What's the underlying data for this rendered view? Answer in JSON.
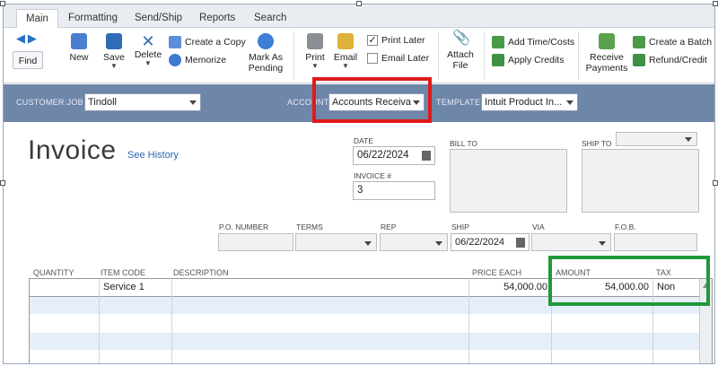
{
  "tabs": [
    "Main",
    "Formatting",
    "Send/Ship",
    "Reports",
    "Search"
  ],
  "toolbar": {
    "find": "Find",
    "new": "New",
    "save": "Save",
    "delete": "Delete",
    "create_copy": "Create a Copy",
    "memorize": "Memorize",
    "mark_as_pending_1": "Mark As",
    "mark_as_pending_2": "Pending",
    "print": "Print",
    "email": "Email",
    "print_later": "Print Later",
    "email_later": "Email Later",
    "attach_file_1": "Attach",
    "attach_file_2": "File",
    "add_time_costs": "Add Time/Costs",
    "apply_credits": "Apply Credits",
    "receive_payments_1": "Receive",
    "receive_payments_2": "Payments",
    "create_batch": "Create a Batch",
    "refund_credit": "Refund/Credit"
  },
  "header": {
    "customer_job_label": "CUSTOMER:JOB",
    "customer_job_value": "Tindoll",
    "account_label": "ACCOUNT",
    "account_value": "Accounts Receiva",
    "template_label": "TEMPLATE",
    "template_value": "Intuit Product In..."
  },
  "form": {
    "title": "Invoice",
    "see_history": "See History",
    "date_label": "DATE",
    "date_value": "06/22/2024",
    "invoice_no_label": "INVOICE #",
    "invoice_no_value": "3",
    "bill_to_label": "BILL TO",
    "ship_to_label": "SHIP TO",
    "po_number_label": "P.O. NUMBER",
    "terms_label": "TERMS",
    "rep_label": "REP",
    "ship_label": "SHIP",
    "ship_value": "06/22/2024",
    "via_label": "VIA",
    "fob_label": "F.O.B."
  },
  "table": {
    "headers": {
      "quantity": "QUANTITY",
      "item_code": "ITEM CODE",
      "description": "DESCRIPTION",
      "price_each": "PRICE EACH",
      "amount": "AMOUNT",
      "tax": "TAX"
    },
    "rows": [
      {
        "quantity": "",
        "item_code": "Service 1",
        "description": "",
        "price_each": "54,000.00",
        "amount": "54,000.00",
        "tax": "Non"
      }
    ]
  }
}
